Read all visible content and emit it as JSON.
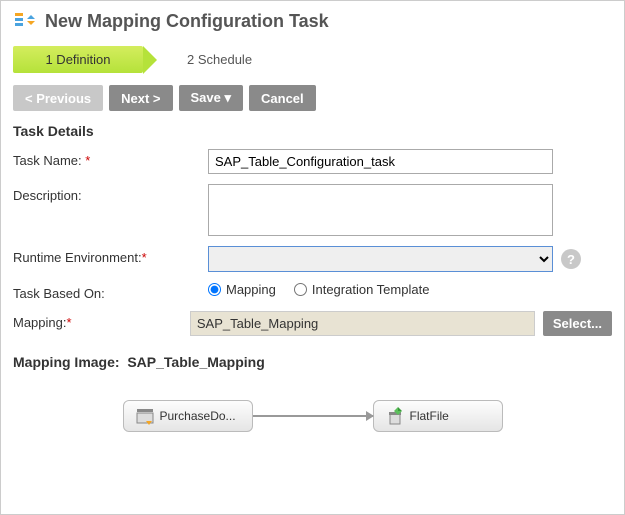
{
  "header": {
    "title": "New Mapping Configuration Task"
  },
  "tabs": {
    "active": "1  Definition",
    "inactive": "2  Schedule"
  },
  "buttons": {
    "previous": "< Previous",
    "next": "Next >",
    "save": "Save ▾",
    "cancel": "Cancel",
    "select": "Select..."
  },
  "section": {
    "title": "Task Details"
  },
  "labels": {
    "taskName": "Task Name:",
    "description": "Description:",
    "runtimeEnv": "Runtime Environment:",
    "taskBasedOn": "Task Based On:",
    "mapping": "Mapping:"
  },
  "values": {
    "taskName": "SAP_Table_Configuration_task",
    "description": "",
    "runtimeEnv": "",
    "mapping": "SAP_Table_Mapping"
  },
  "radios": {
    "mapping": "Mapping",
    "template": "Integration Template"
  },
  "mappingImage": {
    "label": "Mapping Image:",
    "name": "SAP_Table_Mapping"
  },
  "diagram": {
    "source": "PurchaseDo...",
    "target": "FlatFile"
  }
}
